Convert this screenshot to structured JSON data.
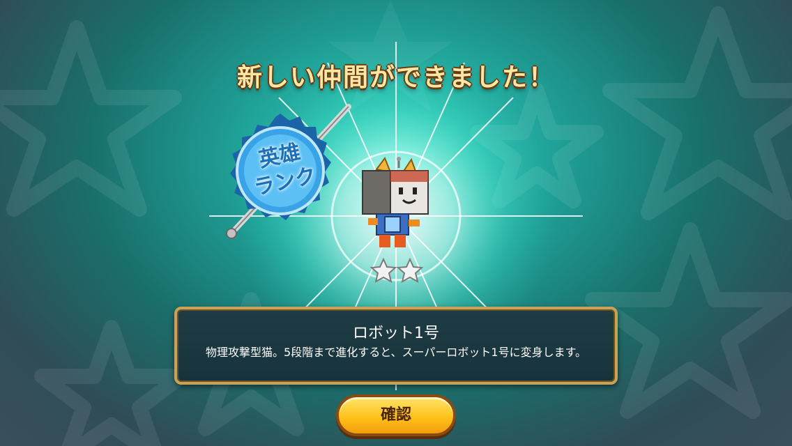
{
  "header": {
    "title": "新しい仲間ができました！"
  },
  "rank_badge": {
    "line1": "英雄",
    "line2": "ランク",
    "icon": "medal-badge-icon"
  },
  "character": {
    "icon": "robot-cat-character",
    "star_count": 2
  },
  "info_panel": {
    "name": "ロボット1号",
    "description": "物理攻撃型猫。5段階まで進化すると、スーパーロボット1号に変身します。"
  },
  "confirm_button": {
    "label": "確認"
  },
  "colors": {
    "title": "#ffe7a6",
    "badge": "#3aa3e8",
    "button": "#ffc21a",
    "panel_border": "#c9a25a"
  }
}
